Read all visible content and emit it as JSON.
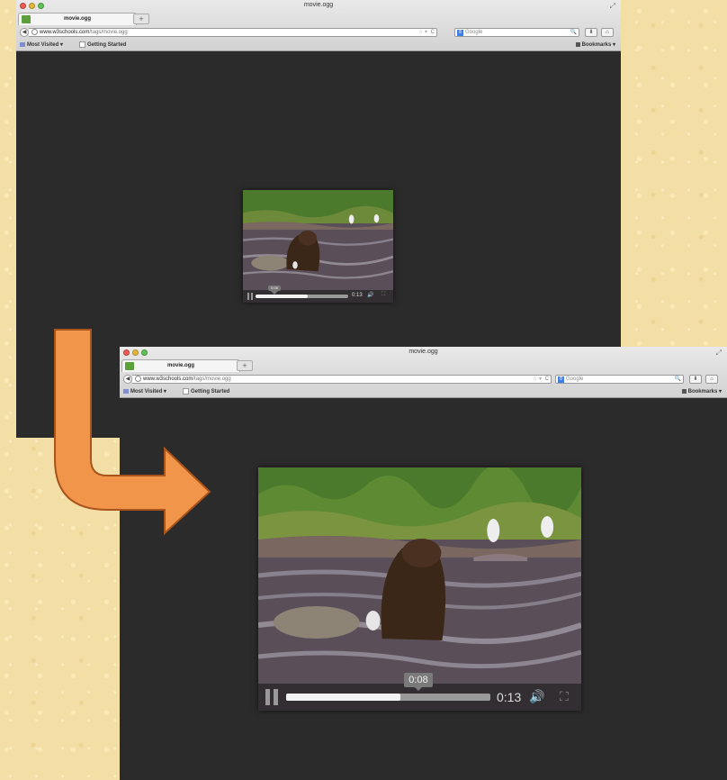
{
  "browser": {
    "window_title": "movie.ogg",
    "tab_title": "movie.ogg",
    "new_tab": "+",
    "back": "◀",
    "url_host": "www.w3schools.com",
    "url_path": "/tags/movie.ogg",
    "star": "☆ ▾",
    "reload": "C",
    "search_engine": "8",
    "search_placeholder": "Google",
    "search_icon": "🔍",
    "download_icon": "⬇",
    "home_icon": "⌂",
    "resize_icon": "⤢",
    "bookmarks_toolbar": {
      "most_visited": "Most Visited ▾",
      "getting_started": "Getting Started",
      "bookmarks": "Bookmarks ▾"
    }
  },
  "video": {
    "elapsed_tooltip": "0:08",
    "duration": "0:13",
    "progress": 0.56,
    "volume_icon": "🔊",
    "fullscreen_icon": "⛶"
  },
  "annotation": {
    "arrow_color": "#f0954a"
  }
}
